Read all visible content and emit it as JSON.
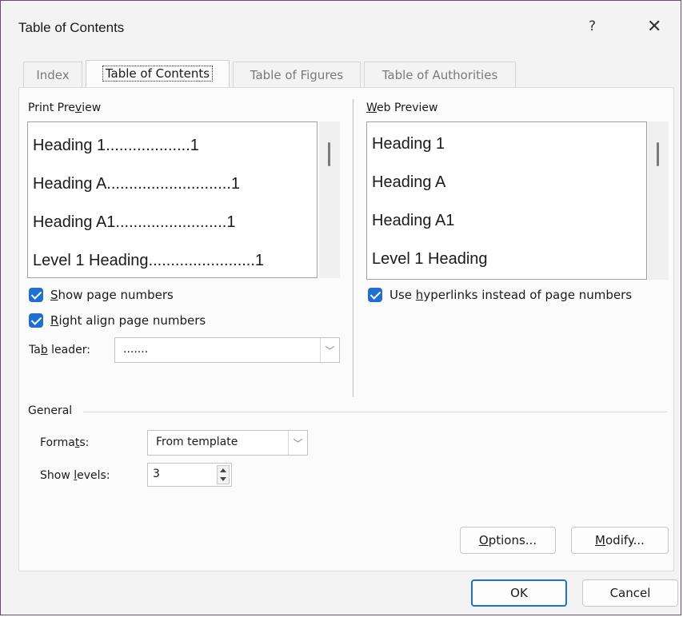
{
  "window": {
    "title": "Table of Contents",
    "help": "?",
    "close": "✕"
  },
  "tabs": [
    {
      "label": "Index",
      "active": false
    },
    {
      "label": "Table of Contents",
      "active": true
    },
    {
      "label": "Table of Figures",
      "active": false
    },
    {
      "label": "Table of Authorities",
      "active": false
    }
  ],
  "print_preview": {
    "label_pre": "Print Pre",
    "label_u": "v",
    "label_post": "iew",
    "lines": [
      {
        "text": "Heading 1",
        "leader": "...................",
        "page": "1"
      },
      {
        "text": "Heading A",
        "leader": "............................",
        "page": "1"
      },
      {
        "text": "Heading A1",
        "leader": ".........................",
        "page": "1"
      },
      {
        "text": "Level 1 Heading",
        "leader": "........................",
        "page": "1"
      }
    ]
  },
  "web_preview": {
    "label_u": "W",
    "label_post": "eb Preview",
    "lines": [
      "Heading 1",
      "Heading A",
      "Heading A1",
      "Level 1 Heading"
    ]
  },
  "options": {
    "show_page_numbers_u": "S",
    "show_page_numbers_post": "how page numbers",
    "right_align_u": "R",
    "right_align_post": "ight align page numbers",
    "use_hyperlinks_pre": "Use ",
    "use_hyperlinks_u": "h",
    "use_hyperlinks_post": "yperlinks instead of page numbers",
    "tab_leader_pre": "Ta",
    "tab_leader_u": "b",
    "tab_leader_post": " leader:",
    "tab_leader_value": ".......",
    "accent_color": "#1f6fd1"
  },
  "general": {
    "label": "General",
    "formats_pre": "Forma",
    "formats_u": "t",
    "formats_post": "s:",
    "formats_value": "From template",
    "levels_pre": "Show ",
    "levels_u": "l",
    "levels_post": "evels:",
    "levels_value": "3"
  },
  "buttons": {
    "options_u": "O",
    "options_post": "ptions...",
    "modify_u": "M",
    "modify_post": "odify...",
    "ok": "OK",
    "cancel": "Cancel"
  }
}
